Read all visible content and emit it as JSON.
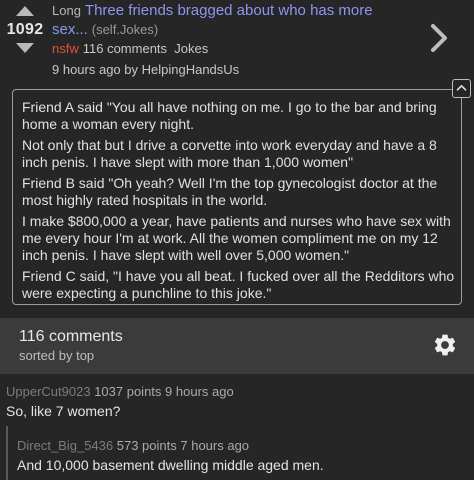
{
  "post": {
    "score": "1092",
    "flair": "Long",
    "title": "Three friends bragged about who has more sex...",
    "domain": "(self.Jokes)",
    "nsfw": "nsfw",
    "comments_count": "116 comments",
    "subreddit": "Jokes",
    "age_author": "9 hours ago by HelpingHandsUs",
    "body": [
      "Friend A said \"You all have nothing on me. I go to the bar and bring home a woman every night.",
      "Not only that but I drive a corvette into work everyday and have a 8 inch penis. I have slept with more than 1,000 women\"",
      "Friend B said \"Oh yeah? Well I'm the top gynecologist doctor at the most highly rated hospitals in the world.",
      "I make $800,000 a year, have patients and nurses who have sex with me every hour I'm at work. All the women compliment me on my 12 inch penis. I have slept with well over 5,000 women.\"",
      "Friend C said, \"I have you all beat. I fucked over all the Redditors who were expecting a punchline to this joke.\""
    ]
  },
  "comments_header": {
    "count": "116 comments",
    "sort": "sorted by top"
  },
  "comments": [
    {
      "user": "UpperCut9023",
      "points": "1037 points",
      "age": "9 hours ago",
      "text": "So, like 7 women?"
    },
    {
      "user": "Direct_Big_5436",
      "points": "573 points",
      "age": "7 hours ago",
      "text": "And 10,000 basement dwelling middle aged men."
    }
  ],
  "colors": {
    "title_link": "#8c96f0",
    "nsfw": "#e0503c",
    "background": "#262626",
    "comments_bar": "#3b3b3b"
  },
  "icons": [
    "upvote-arrow-icon",
    "downvote-arrow-icon",
    "chevron-right-icon",
    "collapse-icon",
    "gear-icon"
  ]
}
